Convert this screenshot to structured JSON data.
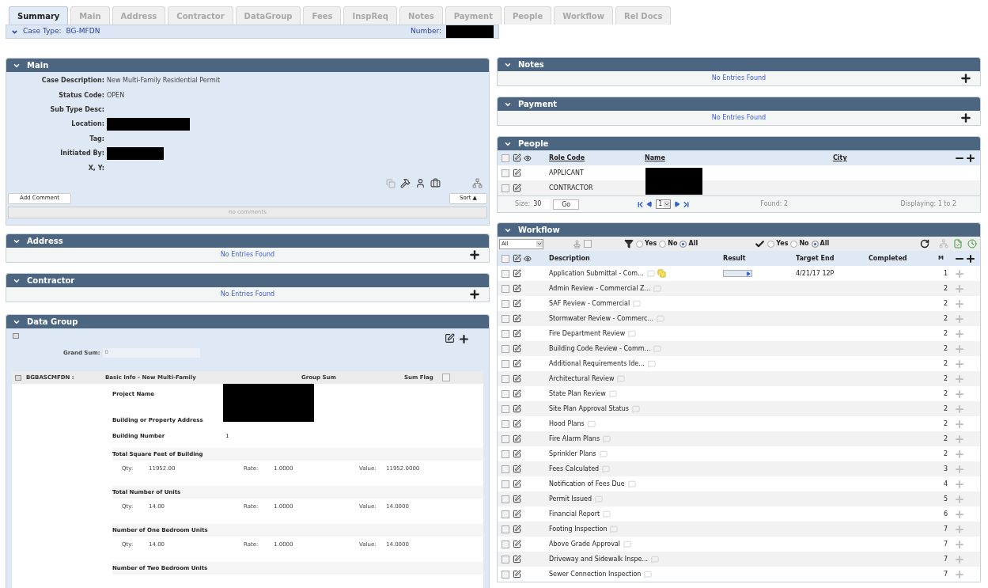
{
  "tabs": [
    {
      "label": "Summary",
      "selected": true
    },
    {
      "label": "Main",
      "selected": false
    },
    {
      "label": "Address",
      "selected": false
    },
    {
      "label": "Contractor",
      "selected": false
    },
    {
      "label": "DataGroup",
      "selected": false
    },
    {
      "label": "Fees",
      "selected": false
    },
    {
      "label": "InspReq",
      "selected": false
    },
    {
      "label": "Notes",
      "selected": false
    },
    {
      "label": "Payment",
      "selected": false
    },
    {
      "label": "People",
      "selected": false
    },
    {
      "label": "Workflow",
      "selected": false
    },
    {
      "label": "Rel Docs",
      "selected": false
    }
  ],
  "case_bar": {
    "case_type_label": "Case Type:",
    "case_type": "BG-MFDN",
    "number_label": "Number:",
    "number_redacted": true
  },
  "main": {
    "title": "Main",
    "fields": [
      {
        "label": "Case Description:",
        "value": "New Multi-Family Residential Permit",
        "redacted": false
      },
      {
        "label": "Status Code:",
        "value": "OPEN",
        "redacted": false
      },
      {
        "label": "Sub Type Desc:",
        "redacted": false
      },
      {
        "label": "Location:",
        "redacted": true
      },
      {
        "label": "Tag:",
        "redacted": false
      },
      {
        "label": "Initiated By:",
        "redacted": true
      },
      {
        "label": "X, Y:",
        "redacted": false
      }
    ],
    "add_comment": "Add Comment",
    "sort": "Sort ▲",
    "comments": "no comments"
  },
  "address": {
    "title": "Address",
    "empty": "No Entries Found"
  },
  "contractor": {
    "title": "Contractor",
    "empty": "No Entries Found"
  },
  "data_group": {
    "title": "Data Group",
    "grand_sum_label": "Grand Sum:",
    "grand_sum": "0",
    "group_code": "BGBASCMFDN :",
    "group_name": "Basic Info - New Multi-Family",
    "group_sum": "Group Sum",
    "sum_flag": "Sum Flag",
    "sum_flag_checked": false,
    "redacted_labels": [
      "Project Name",
      "Building or Property Address"
    ],
    "building_number_label": "Building Number",
    "building_number": "1",
    "calcs": [
      {
        "label": "Total Square Feet of Building",
        "qty_label": "Qty:",
        "qty": "11952.00",
        "rate_label": "Rate:",
        "rate": "1.0000",
        "value_label": "Value:",
        "value": "11952.0000"
      },
      {
        "label": "Total Number of Units",
        "qty_label": "Qty:",
        "qty": "14.00",
        "rate_label": "Rate:",
        "rate": "1.0000",
        "value_label": "Value:",
        "value": "14.0000"
      },
      {
        "label": "Number of One Bedroom Units",
        "qty_label": "Qty:",
        "qty": "14.00",
        "rate_label": "Rate:",
        "rate": "1.0000",
        "value_label": "Value:",
        "value": "14.0000"
      },
      {
        "label": "Number of Two Bedroom Units"
      }
    ]
  },
  "notes": {
    "title": "Notes",
    "empty": "No Entries Found"
  },
  "payment": {
    "title": "Payment",
    "empty": "No Entries Found"
  },
  "people": {
    "title": "People",
    "select_all_checked": false,
    "columns": [
      "Role Code",
      "Name",
      "City"
    ],
    "rows": [
      {
        "role_code": "APPLICANT",
        "checked": false
      },
      {
        "role_code": "CONTRACTOR",
        "checked": false
      }
    ],
    "size_label": "Size:",
    "size": "30",
    "go": "Go",
    "page": "1",
    "found": "Found: 2",
    "displaying": "Displaying: 1 to 2"
  },
  "workflow": {
    "title": "Workflow",
    "filter_select": "All",
    "toolbar_checkbox_checked": false,
    "select_all_checked": false,
    "filter1": [
      {
        "label": "Yes",
        "selected": false
      },
      {
        "label": "No",
        "selected": false
      },
      {
        "label": "All",
        "selected": true
      }
    ],
    "filter2": [
      {
        "label": "Yes",
        "selected": false
      },
      {
        "label": "No",
        "selected": false
      },
      {
        "label": "All",
        "selected": true
      }
    ],
    "columns": [
      "Description",
      "Result",
      "Target End",
      "Completed",
      "M"
    ],
    "rows": [
      {
        "description": "Application Submittal - Com...",
        "target_end": "4/21/17 12P",
        "m": "1",
        "has_result": true,
        "has_attachment": true,
        "checked": false
      },
      {
        "description": "Admin Review - Commercial Z...",
        "m": "2",
        "has_result": false,
        "has_attachment": false,
        "checked": false
      },
      {
        "description": "SAF Review - Commercial",
        "m": "2",
        "has_result": false,
        "has_attachment": false,
        "checked": false
      },
      {
        "description": "Stormwater Review - Commerc...",
        "m": "2",
        "has_result": false,
        "has_attachment": false,
        "checked": false
      },
      {
        "description": "Fire Department Review",
        "m": "2",
        "has_result": false,
        "has_attachment": false,
        "checked": false
      },
      {
        "description": "Building Code Review - Comm...",
        "m": "2",
        "has_result": false,
        "has_attachment": false,
        "checked": false
      },
      {
        "description": "Additional Requirements Ide...",
        "m": "2",
        "has_result": false,
        "has_attachment": false,
        "checked": false
      },
      {
        "description": "Architectural Review",
        "m": "2",
        "has_result": false,
        "has_attachment": false,
        "checked": false
      },
      {
        "description": "State Plan Review",
        "m": "2",
        "has_result": false,
        "has_attachment": false,
        "checked": false
      },
      {
        "description": "Site Plan Approval Status",
        "m": "2",
        "has_result": false,
        "has_attachment": false,
        "checked": false
      },
      {
        "description": "Hood Plans",
        "m": "2",
        "has_result": false,
        "has_attachment": false,
        "checked": false
      },
      {
        "description": "Fire Alarm Plans",
        "m": "2",
        "has_result": false,
        "has_attachment": false,
        "checked": false
      },
      {
        "description": "Sprinkler Plans",
        "m": "2",
        "has_result": false,
        "has_attachment": false,
        "checked": false
      },
      {
        "description": "Fees Calculated",
        "m": "3",
        "has_result": false,
        "has_attachment": false,
        "checked": false
      },
      {
        "description": "Notification of Fees Due",
        "m": "4",
        "has_result": false,
        "has_attachment": false,
        "checked": false
      },
      {
        "description": "Permit Issued",
        "m": "5",
        "has_result": false,
        "has_attachment": false,
        "checked": false
      },
      {
        "description": "Financial Report",
        "m": "6",
        "has_result": false,
        "has_attachment": false,
        "checked": false
      },
      {
        "description": "Footing Inspection",
        "m": "7",
        "has_result": false,
        "has_attachment": false,
        "checked": false
      },
      {
        "description": "Above Grade Approval",
        "m": "7",
        "has_result": false,
        "has_attachment": false,
        "checked": false
      },
      {
        "description": "Driveway and Sidewalk Inspe...",
        "m": "7",
        "has_result": false,
        "has_attachment": false,
        "checked": false
      },
      {
        "description": "Sewer Connection Inspection",
        "m": "7",
        "has_result": false,
        "has_attachment": false,
        "checked": false
      }
    ]
  }
}
